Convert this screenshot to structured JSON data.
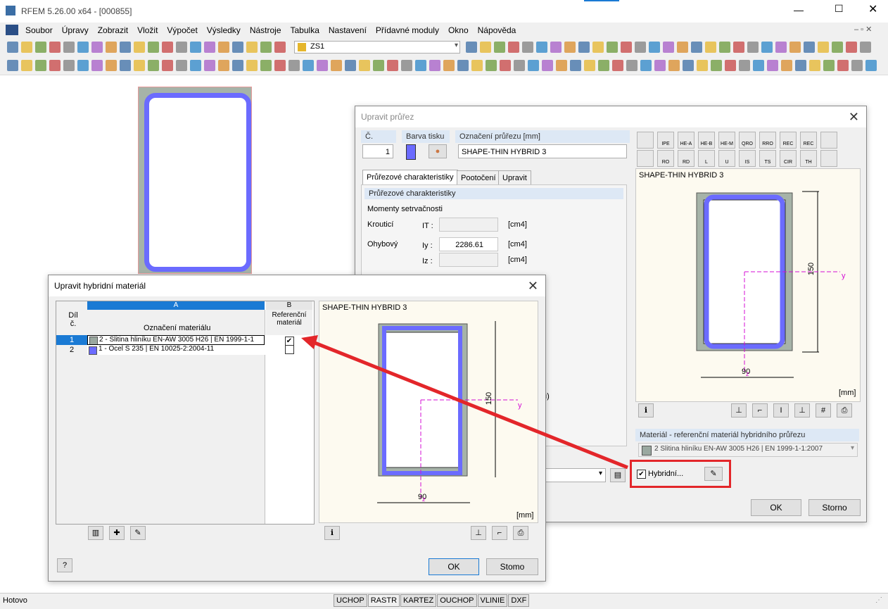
{
  "window": {
    "title": "RFEM 5.26.00 x64 - [000855]"
  },
  "menu": [
    "Soubor",
    "Úpravy",
    "Zobrazit",
    "Vložit",
    "Výpočet",
    "Výsledky",
    "Nástroje",
    "Tabulka",
    "Nastavení",
    "Přídavné moduly",
    "Okno",
    "Nápověda"
  ],
  "toolbar": {
    "loadcase": "ZS1"
  },
  "status": {
    "text": "Hotovo",
    "toggles": [
      "UCHOP",
      "RASTR",
      "KARTEZ",
      "OUCHOP",
      "VLINIE",
      "DXF"
    ]
  },
  "section_dialog": {
    "title": "Upravit průřez",
    "no_label": "Č.",
    "no_value": "1",
    "color_label": "Barva tisku",
    "name_label": "Označení průřezu [mm]",
    "name_value": "SHAPE-THIN HYBRID 3",
    "tabs": [
      "Průřezové charakteristiky",
      "Pootočení",
      "Upravit"
    ],
    "section_header": "Průřezové charakteristiky",
    "moments_label": "Momenty setrvačnosti",
    "torsion_label": "Krouticí",
    "bending_label": "Ohybový",
    "it_symbol": "IT :",
    "iy_symbol": "Iy :",
    "iz_symbol": "Iz :",
    "iy_value": "2286.61",
    "unit": "[cm4]",
    "fragment": "u)",
    "icons_row1": [
      "IPE",
      "HE-A",
      "HE-B",
      "HE-M",
      "QRO",
      "RRO",
      "REC",
      "REC"
    ],
    "icons_row2": [
      "RO",
      "RD",
      "L",
      "U",
      "IS",
      "TS",
      "CIR",
      "TH"
    ],
    "preview_title": "SHAPE-THIN HYBRID 3",
    "dim_width": "90",
    "dim_height": "150",
    "axis_y": "y",
    "axis_z": "z",
    "unit_mm": "[mm]",
    "ref_material_header": "Materiál - referenční materiál hybridního průřezu",
    "ref_material_value": "2 Slitina hliníku EN-AW 3005 H26 | EN 1999-1-1:2007",
    "hybrid_label": "Hybridní...",
    "hybrid_checked": "✔",
    "ok": "OK",
    "cancel": "Storno"
  },
  "hybrid_dialog": {
    "title": "Upravit hybridní materiál",
    "col_a": "A",
    "col_b": "B",
    "col_part": "Díl č.",
    "col_material": "Označení materiálu",
    "col_ref": "Referenční materiál",
    "rows": [
      {
        "no": "1",
        "material": "2 - Slitina hliníku EN-AW 3005 H26 | EN 1999-1-1",
        "ref": "✔",
        "color": "#9aa8a0"
      },
      {
        "no": "2",
        "material": "1 - Ocel S 235 | EN 10025-2:2004-11",
        "ref": "",
        "color": "#6b6bff"
      }
    ],
    "preview_title": "SHAPE-THIN HYBRID 3",
    "dim_width": "90",
    "dim_height": "150",
    "axis_y": "y",
    "axis_z": "z",
    "unit_mm": "[mm]",
    "ok": "OK",
    "cancel": "Stomo"
  },
  "colors": {
    "steel": "#6b6bff",
    "alu": "#9aa8a0",
    "highlight": "#e3262a",
    "accent": "#1a7ad4"
  }
}
